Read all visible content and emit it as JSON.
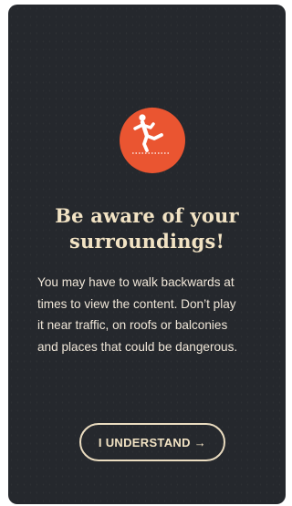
{
  "dialog": {
    "title_lines": [
      "Be aware of your",
      "surroundings!"
    ],
    "body_lines": [
      "You may have to walk backwards at",
      "times to view the content. Don’t play",
      "it near traffic, on roofs or balconies",
      "and places that could be dangerous."
    ],
    "button": {
      "label": "I UNDERSTAND",
      "arrow": "→"
    },
    "icon": "person-tripping-icon"
  },
  "colors": {
    "background": "#25282d",
    "accent": "#ea5531",
    "text": "#f2e3c4"
  }
}
